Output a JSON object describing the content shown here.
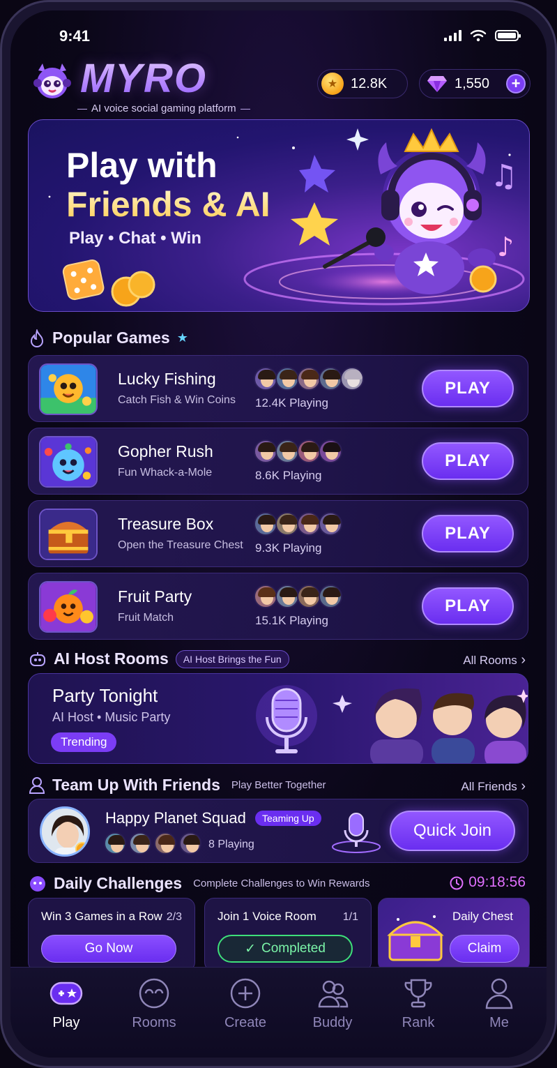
{
  "status": {
    "time": "9:41"
  },
  "header": {
    "brand": "MYRO",
    "tagline": "AI voice social gaming platform",
    "coins": "12.8K",
    "gems": "1,550"
  },
  "hero": {
    "title_line1": "Play with",
    "title_line2": "Friends & AI",
    "subtitle": "Play • Chat • Win"
  },
  "popular": {
    "title": "Popular Games",
    "games": [
      {
        "name": "Lucky Fishing",
        "desc": "Catch Fish & Win Coins",
        "playing": "12.4K Playing",
        "button": "PLAY"
      },
      {
        "name": "Gopher Rush",
        "desc": "Fun Whack-a-Mole",
        "playing": "8.6K Playing",
        "button": "PLAY"
      },
      {
        "name": "Treasure Box",
        "desc": "Open the Treasure Chest",
        "playing": "9.3K Playing",
        "button": "PLAY"
      },
      {
        "name": "Fruit Party",
        "desc": "Fruit Match",
        "playing": "15.1K Playing",
        "button": "PLAY"
      }
    ]
  },
  "ai_rooms": {
    "title": "AI Host Rooms",
    "badge": "AI Host Brings the Fun",
    "link": "All Rooms",
    "room_title": "Party Tonight",
    "room_sub": "AI Host • Music Party",
    "tag": "Trending"
  },
  "team": {
    "title": "Team Up With Friends",
    "subtitle": "Play Better Together",
    "link": "All Friends",
    "squad": "Happy Planet Squad",
    "badge": "Teaming Up",
    "playing": "8 Playing",
    "button": "Quick Join"
  },
  "challenges": {
    "title": "Daily Challenges",
    "subtitle": "Complete Challenges to Win Rewards",
    "timer": "09:18:56",
    "c1": {
      "text": "Win 3 Games in a Row",
      "count": "2/3",
      "button": "Go Now"
    },
    "c2": {
      "text": "Join 1 Voice Room",
      "count": "1/1",
      "button": "Completed"
    },
    "c3": {
      "text": "Daily Chest",
      "button": "Claim"
    }
  },
  "nav": {
    "items": [
      "Play",
      "Rooms",
      "Create",
      "Buddy",
      "Rank",
      "Me"
    ]
  },
  "colors": {
    "accent": "#7b3df5",
    "gold": "#ffcf5a",
    "success": "#3ee07a",
    "timer": "#e070ff"
  }
}
